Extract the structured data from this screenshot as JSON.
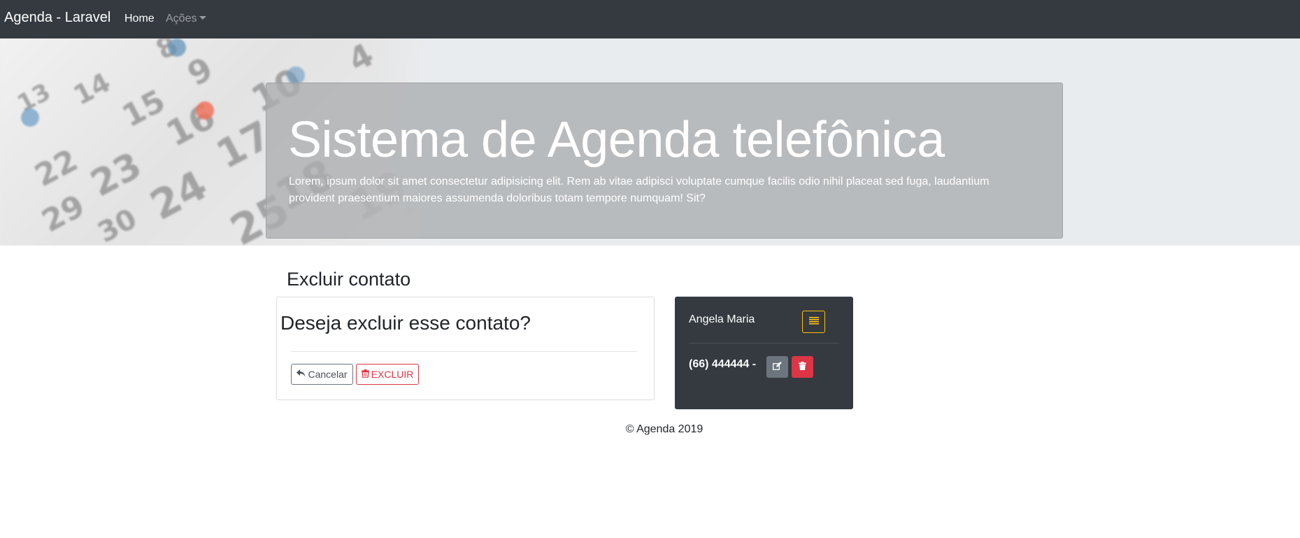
{
  "navbar": {
    "brand": "Agenda - Laravel",
    "home": "Home",
    "acoes": "Ações",
    "background": "#343a40"
  },
  "hero": {
    "title": "Sistema de Agenda telefônica",
    "lead": "Lorem, ipsum dolor sit amet consectetur adipisicing elit. Rem ab vitae adipisci voluptate cumque facilis odio nihil placeat sed fuga, laudantium provident praesentium maiores assumenda doloribus totam tempore numquam! Sit?",
    "background_image": "calendar-photo"
  },
  "page": {
    "title": "Excluir contato"
  },
  "delete_card": {
    "question": "Deseja excluir esse contato?",
    "cancel_label": "Cancelar",
    "cancel_icon": "reply-icon",
    "delete_label": "EXCLUIR",
    "delete_icon": "trash-icon"
  },
  "contact": {
    "name": "Angela Maria",
    "phone": "(66) 444444 -",
    "menu_icon": "list-icon",
    "edit_icon": "edit-icon",
    "delete_icon": "trash-icon"
  },
  "footer": {
    "text": "© Agenda 2019"
  },
  "colors": {
    "danger": "#dc3545",
    "warning": "#ffc107",
    "secondary": "#6c757d",
    "dark": "#343a40",
    "hero_bg": "#e9ecef"
  }
}
